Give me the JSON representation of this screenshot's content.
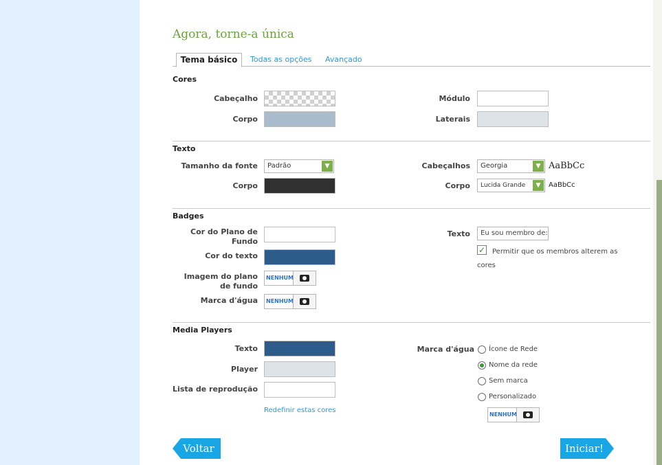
{
  "title": "Agora, torne-a única",
  "tabs": [
    {
      "label": "Tema básico",
      "active": true
    },
    {
      "label": "Todas as opções",
      "active": false
    },
    {
      "label": "Avançado",
      "active": false
    }
  ],
  "cores": {
    "section": "Cores",
    "cabecalho_label": "Cabeçalho",
    "corpo_label": "Corpo",
    "modulo_label": "Módulo",
    "laterais_label": "Laterais",
    "corpo_color": "#a9bccd",
    "modulo_color": "#ffffff",
    "laterais_color": "#dde3e6"
  },
  "texto": {
    "section": "Texto",
    "tamanho_label": "Tamanho da fonte",
    "tamanho_value": "Padrão",
    "corpo_label": "Corpo",
    "corpo_color": "#303030",
    "cabecalhos_label": "Cabeçalhos",
    "cabecalhos_font": "Georgia",
    "cabecalhos_preview": "AaBbCc",
    "corpo2_label": "Corpo",
    "corpo_font": "Lucida Grande",
    "corpo_preview": "AaBbCc"
  },
  "badges": {
    "section": "Badges",
    "bg_color_label": "Cor do Plano de Fundo",
    "text_color_label": "Cor do texto",
    "text_color": "#2e5c8a",
    "bg_image_label": "Imagem do plano de fundo",
    "watermark_label": "Marca d'água",
    "none_label": "NENHUM",
    "texto_label": "Texto",
    "texto_value": "Eu sou membro de:",
    "allow_label": "Permitir que os membros alterem as cores",
    "allow_checked": true
  },
  "media_players": {
    "section": "Media Players",
    "texto_label": "Texto",
    "texto_color": "#2e5c8a",
    "player_label": "Player",
    "player_color": "#dde3e6",
    "lista_label": "Lista de reprodução",
    "lista_color": "#ffffff",
    "reset_link": "Redefinir estas cores",
    "marca_label": "Marca d'água",
    "options": [
      {
        "label": "Ícone de Rede",
        "selected": false
      },
      {
        "label": "Nome da rede",
        "selected": true
      },
      {
        "label": "Sem marca",
        "selected": false
      },
      {
        "label": "Personalizado",
        "selected": false
      }
    ],
    "none_label": "NENHUM"
  },
  "buttons": {
    "back": "Voltar",
    "start": "Iniciar!"
  }
}
